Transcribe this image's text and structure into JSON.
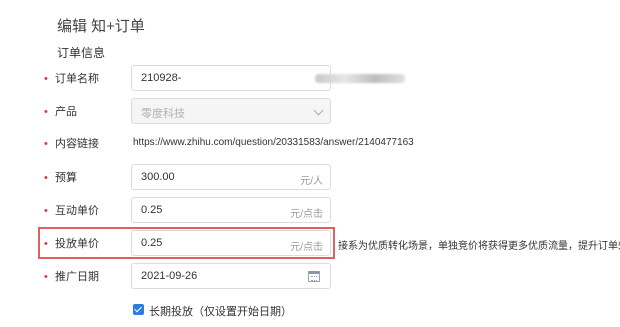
{
  "page": {
    "title": "编辑 知+订单",
    "section": "订单信息"
  },
  "form": {
    "order_name": {
      "label": "订单名称",
      "value": "210928-"
    },
    "product": {
      "label": "产品",
      "value": "零度科技"
    },
    "content_link": {
      "label": "内容链接",
      "value": "https://www.zhihu.com/question/20331583/answer/2140477163"
    },
    "budget": {
      "label": "预算",
      "value": "300.00",
      "unit": "元/人"
    },
    "interaction_price": {
      "label": "互动单价",
      "value": "0.25",
      "unit": "元/点击"
    },
    "bid_price": {
      "label": "投放单价",
      "value": "0.25",
      "unit": "元/点击"
    },
    "bid_hint": "接系为优质转化场景，单独竞价将获得更多优质流量，提升订单效果",
    "promo_date": {
      "label": "推广日期",
      "value": "2021-09-26"
    },
    "long_term": {
      "label": "长期投放（仅设置开始日期）",
      "checked": true
    }
  },
  "colors": {
    "required": "#e4393c",
    "highlight": "#e06060",
    "checkbox": "#2f7ce0"
  }
}
